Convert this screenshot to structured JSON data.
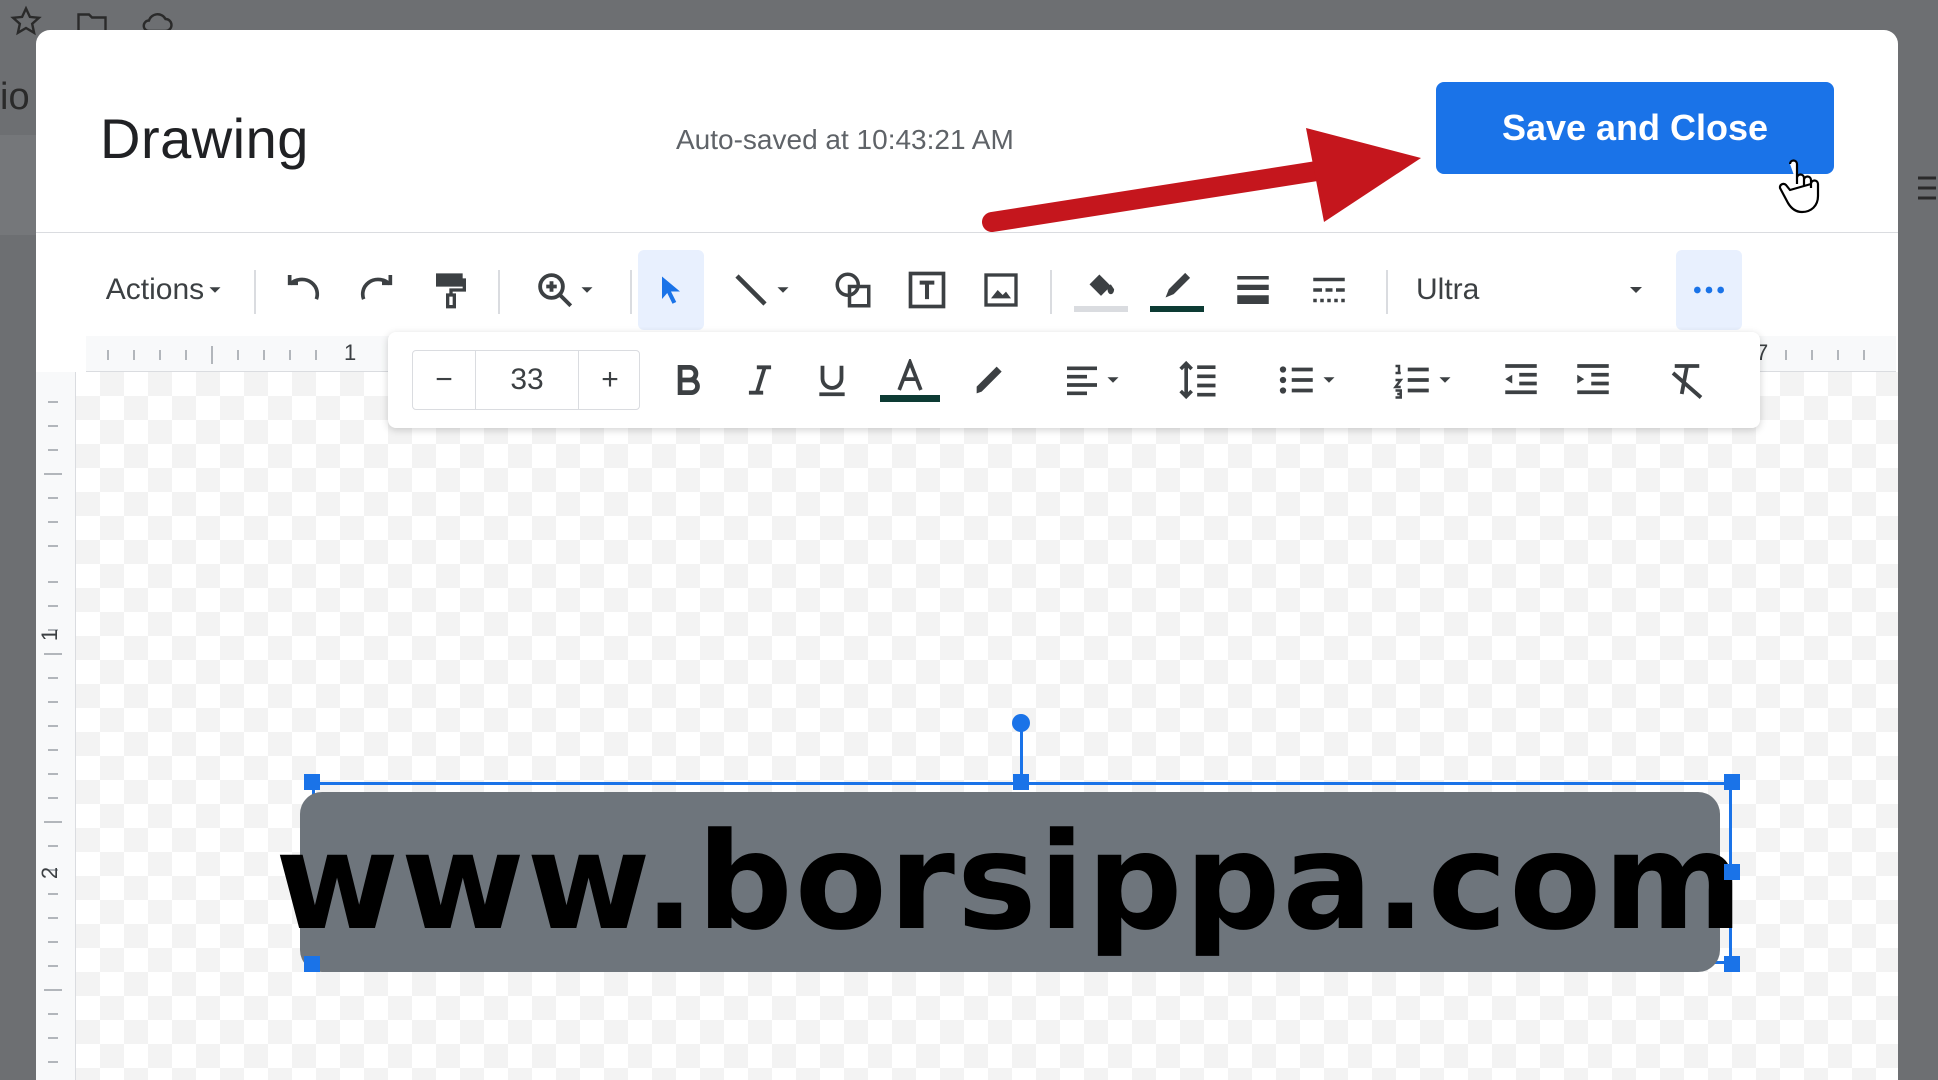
{
  "dialog": {
    "title": "Drawing",
    "autosave_status": "Auto-saved at 10:43:21 AM",
    "save_button_label": "Save and Close"
  },
  "background": {
    "partial_text": "io"
  },
  "toolbar": {
    "actions_label": "Actions",
    "font_name": "Ultra",
    "icons": [
      "undo-icon",
      "redo-icon",
      "paint-format-icon",
      "zoom-icon",
      "select-icon",
      "line-icon",
      "shape-icon",
      "text-box-icon",
      "image-icon",
      "fill-color-icon",
      "border-color-icon",
      "border-weight-icon",
      "border-dash-icon",
      "more-icon"
    ]
  },
  "format_bar": {
    "decrease_label": "−",
    "font_size": "33",
    "increase_label": "+",
    "icons": [
      "bold-icon",
      "italic-icon",
      "underline-icon",
      "text-color-icon",
      "highlight-icon",
      "align-icon",
      "line-spacing-icon",
      "bulleted-list-icon",
      "numbered-list-icon",
      "decrease-indent-icon",
      "increase-indent-icon",
      "clear-formatting-icon"
    ]
  },
  "rulers": {
    "top_numbers": [
      "1",
      "7"
    ],
    "left_numbers": [
      "1",
      "2"
    ]
  },
  "canvas": {
    "text_box_content": "www.borsippa.com"
  },
  "colors": {
    "accent": "#1a73e8",
    "text_box_fill": "#6e757c",
    "arrow": "#c5161d"
  }
}
